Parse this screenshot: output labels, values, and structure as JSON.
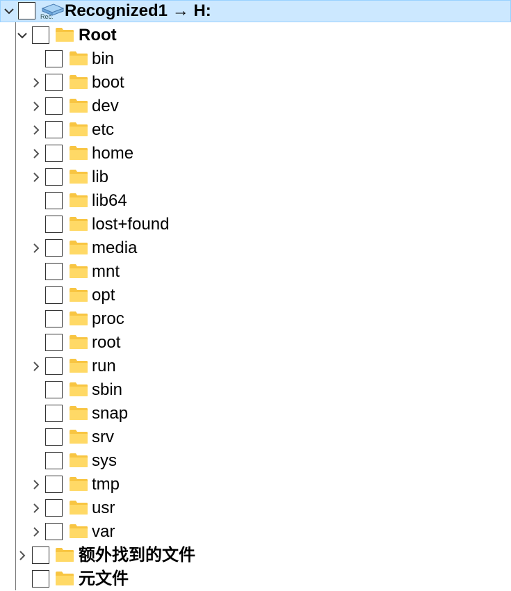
{
  "tree": {
    "root_item": {
      "label": "Recognized1 → H:",
      "badge": "Rec.",
      "expanded": true,
      "selected": true
    },
    "root_folder": {
      "label": "Root",
      "expanded": true
    },
    "children": [
      {
        "label": "bin",
        "expandable": false
      },
      {
        "label": "boot",
        "expandable": true
      },
      {
        "label": "dev",
        "expandable": true
      },
      {
        "label": "etc",
        "expandable": true
      },
      {
        "label": "home",
        "expandable": true
      },
      {
        "label": "lib",
        "expandable": true
      },
      {
        "label": "lib64",
        "expandable": false
      },
      {
        "label": "lost+found",
        "expandable": false
      },
      {
        "label": "media",
        "expandable": true
      },
      {
        "label": "mnt",
        "expandable": false
      },
      {
        "label": "opt",
        "expandable": false
      },
      {
        "label": "proc",
        "expandable": false
      },
      {
        "label": "root",
        "expandable": false
      },
      {
        "label": "run",
        "expandable": true
      },
      {
        "label": "sbin",
        "expandable": false
      },
      {
        "label": "snap",
        "expandable": false
      },
      {
        "label": "srv",
        "expandable": false
      },
      {
        "label": "sys",
        "expandable": false
      },
      {
        "label": "tmp",
        "expandable": true
      },
      {
        "label": "usr",
        "expandable": true
      },
      {
        "label": "var",
        "expandable": true
      }
    ],
    "extra_found": {
      "label": "额外找到的文件",
      "expandable": true
    },
    "metafiles": {
      "label": "元文件",
      "expandable": false
    }
  },
  "colors": {
    "selection": "#cce8ff",
    "selection_border": "#99d1ff",
    "folder": "#f8c542",
    "folder_light": "#ffe08a"
  }
}
